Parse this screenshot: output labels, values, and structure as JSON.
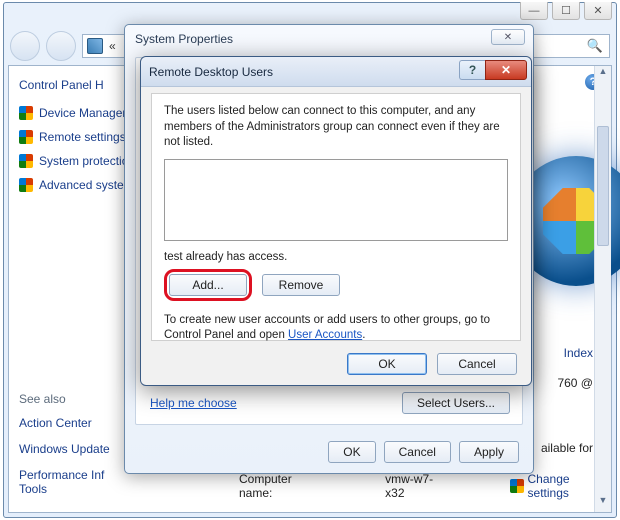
{
  "window": {
    "min_glyph": "—",
    "max_glyph": "☐",
    "close_glyph": "✕"
  },
  "addressbar": {
    "chevron": "«"
  },
  "search": {
    "icon": "🔍"
  },
  "help_icon": "?",
  "sidebar": {
    "cp_home": "Control Panel H",
    "items": [
      {
        "label": "Device Manager"
      },
      {
        "label": "Remote settings"
      },
      {
        "label": "System protection"
      },
      {
        "label": "Advanced system"
      }
    ],
    "see_also_heading": "See also",
    "see_also": [
      {
        "label": "Action Center"
      },
      {
        "label": "Windows Update"
      },
      {
        "label": "Performance Inf\nTools"
      }
    ]
  },
  "right_pane": {
    "index_link": "Index",
    "rating_fragment": "760  @",
    "availability_fragment": "ailable for"
  },
  "bottom": {
    "label": "Computer name:",
    "value": "vmw-w7-x32",
    "change": "Change settings"
  },
  "sys_props": {
    "title": "System Properties",
    "close_glyph": "✕",
    "help_link": "Help me choose",
    "select_users": "Select Users...",
    "ok": "OK",
    "cancel": "Cancel",
    "apply": "Apply"
  },
  "rdu": {
    "title": "Remote Desktop Users",
    "help_glyph": "?",
    "close_glyph": "✕",
    "description": "The users listed below can connect to this computer, and any members of the Administrators group can connect even if they are not listed.",
    "access_line": "test already has access.",
    "add": "Add...",
    "remove": "Remove",
    "note_pre": "To create new user accounts or add users to other groups, go to Control Panel and open ",
    "note_link": "User Accounts",
    "note_post": ".",
    "ok": "OK",
    "cancel": "Cancel"
  }
}
